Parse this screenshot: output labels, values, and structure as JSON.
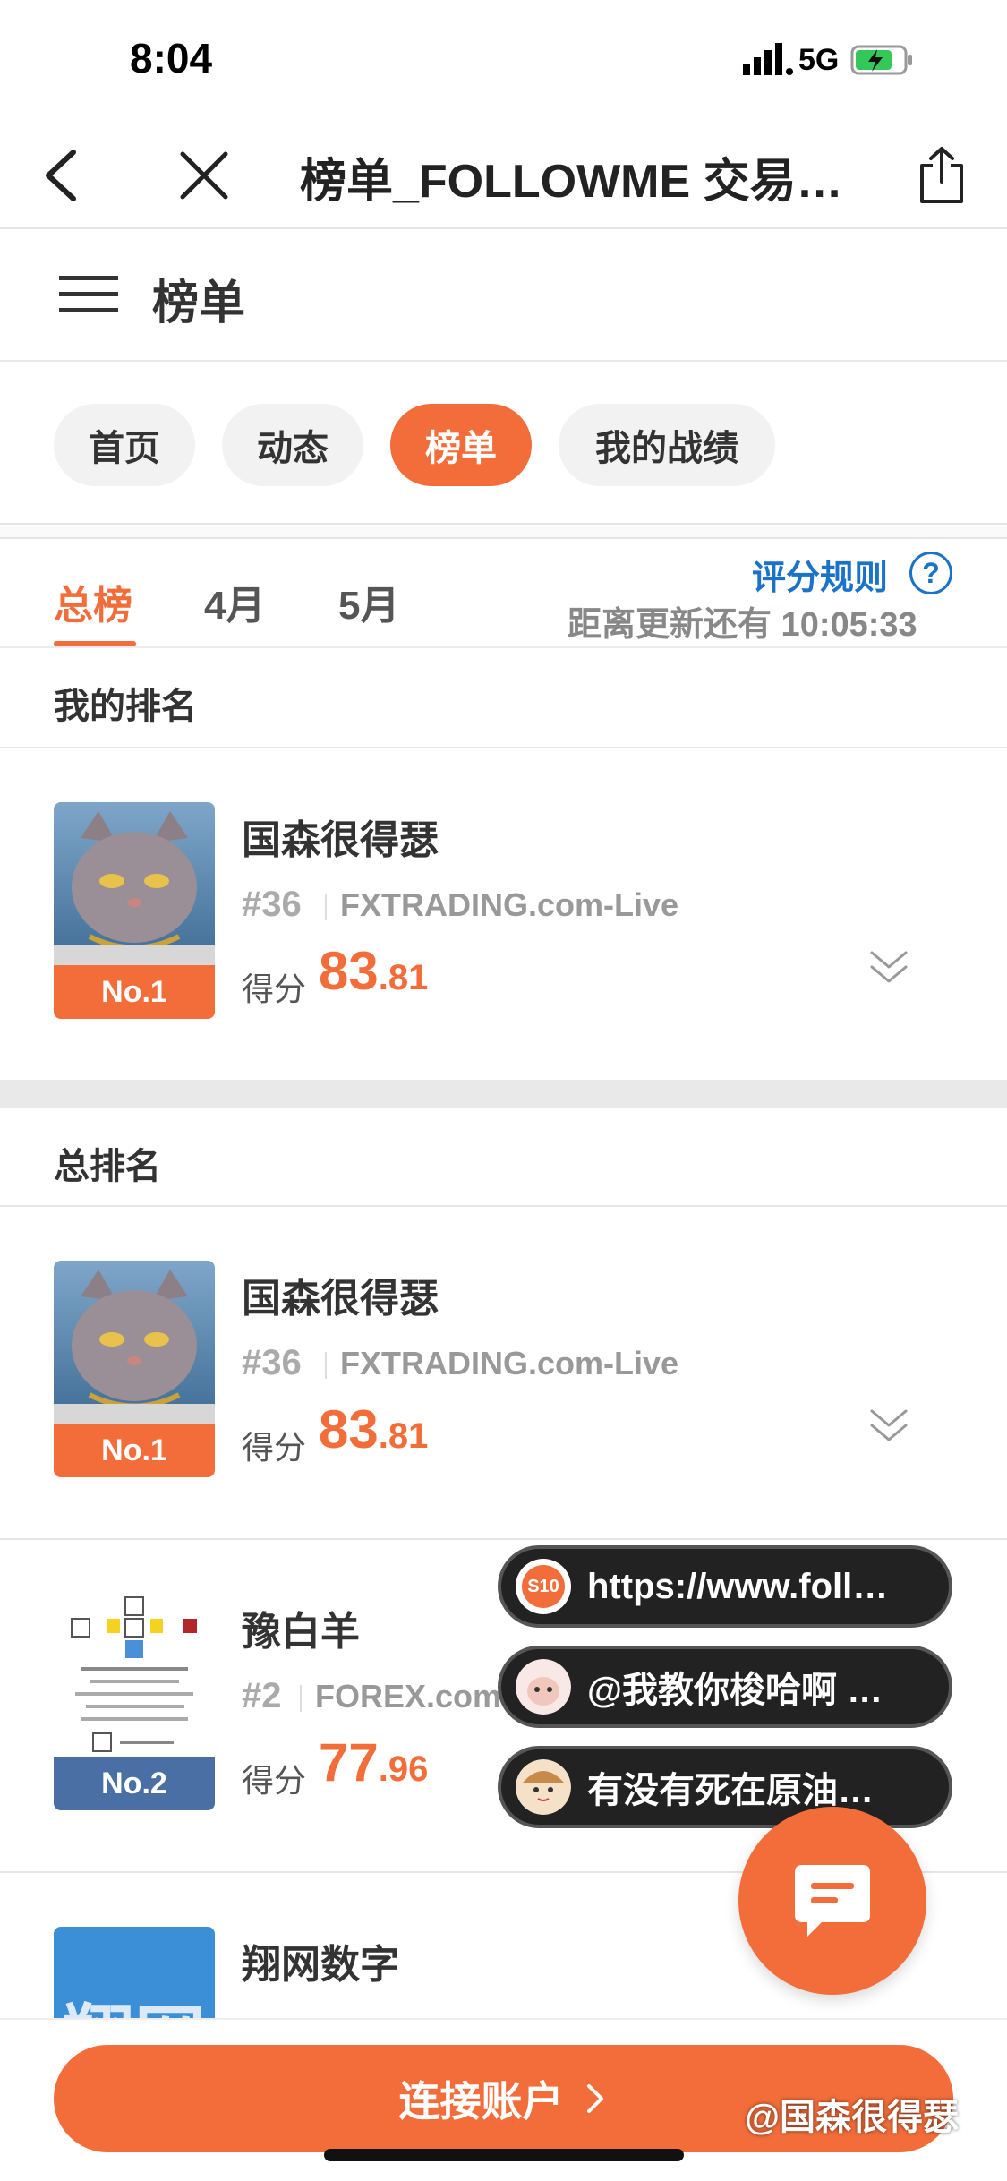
{
  "status_bar": {
    "time": "8:04",
    "network": "5G"
  },
  "browser": {
    "title": "榜单_FOLLOWME 交易…"
  },
  "site": {
    "title": "榜单"
  },
  "pills": [
    {
      "label": "首页"
    },
    {
      "label": "动态"
    },
    {
      "label": "榜单",
      "active": true
    },
    {
      "label": "我的战绩"
    }
  ],
  "rank_tabs": [
    {
      "label": "总榜",
      "active": true
    },
    {
      "label": "4月"
    },
    {
      "label": "5月"
    }
  ],
  "rules_link": "评分规则",
  "countdown": "距离更新还有 10:05:33",
  "my_rank": {
    "title": "我的排名",
    "entry": {
      "name": "国森很得瑟",
      "rank_no": "#36",
      "broker": "FXTRADING.com-Live",
      "badge": "No.1",
      "score_label": "得分",
      "score_int": "83",
      "score_dec": ".81"
    }
  },
  "overall_rank": {
    "title": "总排名",
    "entries": [
      {
        "name": "国森很得瑟",
        "rank_no": "#36",
        "broker": "FXTRADING.com-Live",
        "badge": "No.1",
        "score_label": "得分",
        "score_int": "83",
        "score_dec": ".81"
      },
      {
        "name": "豫白羊",
        "rank_no": "#2",
        "broker": "FOREX.com",
        "badge": "No.2",
        "score_label": "得分",
        "score_int": "77",
        "score_dec": ".96"
      },
      {
        "name": "翔网数字",
        "logo_text": "翔网"
      }
    ]
  },
  "chips": [
    {
      "icon_text": "S10",
      "text": "https://www.foll…"
    },
    {
      "text": "@我教你梭哈啊 …"
    },
    {
      "text": "有没有死在原油…"
    }
  ],
  "connect_button": "连接账户",
  "watermark": "@国森很得瑟",
  "colors": {
    "accent": "#f26d3a",
    "link": "#1a73c8",
    "badge_no2": "#4a6fa5"
  }
}
